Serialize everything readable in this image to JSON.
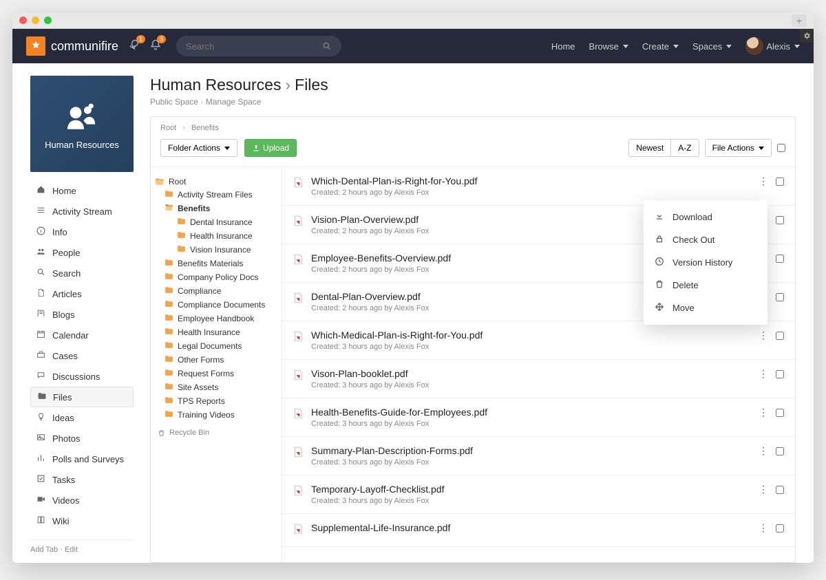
{
  "window": {
    "plus_label": "+"
  },
  "header": {
    "brand": "communifire",
    "badge_chat": "1",
    "badge_bell": "3",
    "search_placeholder": "Search",
    "nav": {
      "home": "Home",
      "browse": "Browse",
      "create": "Create",
      "spaces": "Spaces",
      "user": "Alexis"
    }
  },
  "sidebar": {
    "space_title": "Human Resources",
    "items": [
      {
        "icon": "home-icon",
        "label": "Home"
      },
      {
        "icon": "stream-icon",
        "label": "Activity Stream"
      },
      {
        "icon": "info-icon",
        "label": "Info"
      },
      {
        "icon": "people-icon",
        "label": "People"
      },
      {
        "icon": "search-icon",
        "label": "Search"
      },
      {
        "icon": "article-icon",
        "label": "Articles"
      },
      {
        "icon": "blog-icon",
        "label": "Blogs"
      },
      {
        "icon": "calendar-icon",
        "label": "Calendar"
      },
      {
        "icon": "case-icon",
        "label": "Cases"
      },
      {
        "icon": "discussion-icon",
        "label": "Discussions"
      },
      {
        "icon": "files-icon",
        "label": "Files"
      },
      {
        "icon": "idea-icon",
        "label": "Ideas"
      },
      {
        "icon": "photo-icon",
        "label": "Photos"
      },
      {
        "icon": "poll-icon",
        "label": "Polls and Surveys"
      },
      {
        "icon": "task-icon",
        "label": "Tasks"
      },
      {
        "icon": "video-icon",
        "label": "Videos"
      },
      {
        "icon": "wiki-icon",
        "label": "Wiki"
      }
    ],
    "active_index": 10,
    "footer": {
      "add_tab": "Add Tab",
      "edit": "Edit"
    }
  },
  "main": {
    "title_space": "Human Resources",
    "title_section": "Files",
    "subtitle_public": "Public Space",
    "subtitle_manage": "Manage Space",
    "breadcrumb": [
      "Root",
      "Benefits"
    ],
    "folder_actions_label": "Folder Actions",
    "upload_label": "Upload",
    "sort": {
      "newest": "Newest",
      "az": "A-Z"
    },
    "file_actions_label": "File Actions",
    "tree": {
      "root_label": "Root",
      "items": [
        {
          "label": "Activity Stream Files",
          "depth": 1,
          "open": false
        },
        {
          "label": "Benefits",
          "depth": 1,
          "open": true,
          "selected": true
        },
        {
          "label": "Dental Insurance",
          "depth": 2,
          "open": false
        },
        {
          "label": "Health Insurance",
          "depth": 2,
          "open": false
        },
        {
          "label": "Vision Insurance",
          "depth": 2,
          "open": false
        },
        {
          "label": "Benefits Materials",
          "depth": 1,
          "open": false
        },
        {
          "label": "Company Policy Docs",
          "depth": 1,
          "open": false
        },
        {
          "label": "Compliance",
          "depth": 1,
          "open": false
        },
        {
          "label": "Compliance Documents",
          "depth": 1,
          "open": false
        },
        {
          "label": "Employee Handbook",
          "depth": 1,
          "open": false
        },
        {
          "label": "Health Insurance",
          "depth": 1,
          "open": false
        },
        {
          "label": "Legal Documents",
          "depth": 1,
          "open": false
        },
        {
          "label": "Other Forms",
          "depth": 1,
          "open": false
        },
        {
          "label": "Request Forms",
          "depth": 1,
          "open": false
        },
        {
          "label": "Site Assets",
          "depth": 1,
          "open": false
        },
        {
          "label": "TPS Reports",
          "depth": 1,
          "open": false
        },
        {
          "label": "Training Videos",
          "depth": 1,
          "open": false
        }
      ],
      "recycle_label": "Recycle Bin"
    },
    "files": [
      {
        "name": "Which-Dental-Plan-is-Right-for-You.pdf",
        "meta": "Created: 2 hours ago by Alexis Fox"
      },
      {
        "name": "Vision-Plan-Overview.pdf",
        "meta": "Created: 2 hours ago by Alexis Fox"
      },
      {
        "name": "Employee-Benefits-Overview.pdf",
        "meta": "Created: 2 hours ago by Alexis Fox"
      },
      {
        "name": "Dental-Plan-Overview.pdf",
        "meta": "Created: 2 hours ago by Alexis Fox"
      },
      {
        "name": "Which-Medical-Plan-is-Right-for-You.pdf",
        "meta": "Created: 3 hours ago by Alexis Fox"
      },
      {
        "name": "Vison-Plan-booklet.pdf",
        "meta": "Created: 3 hours ago by Alexis Fox"
      },
      {
        "name": "Health-Benefits-Guide-for-Employees.pdf",
        "meta": "Created: 3 hours ago by Alexis Fox"
      },
      {
        "name": "Summary-Plan-Description-Forms.pdf",
        "meta": "Created: 3 hours ago by Alexis Fox"
      },
      {
        "name": "Temporary-Layoff-Checklist.pdf",
        "meta": "Created: 3 hours ago by Alexis Fox"
      },
      {
        "name": "Supplemental-Life-Insurance.pdf",
        "meta": ""
      }
    ],
    "context_menu": [
      {
        "icon": "download-icon",
        "label": "Download"
      },
      {
        "icon": "lock-icon",
        "label": "Check Out"
      },
      {
        "icon": "history-icon",
        "label": "Version History"
      },
      {
        "icon": "trash-icon",
        "label": "Delete"
      },
      {
        "icon": "move-icon",
        "label": "Move"
      }
    ]
  }
}
